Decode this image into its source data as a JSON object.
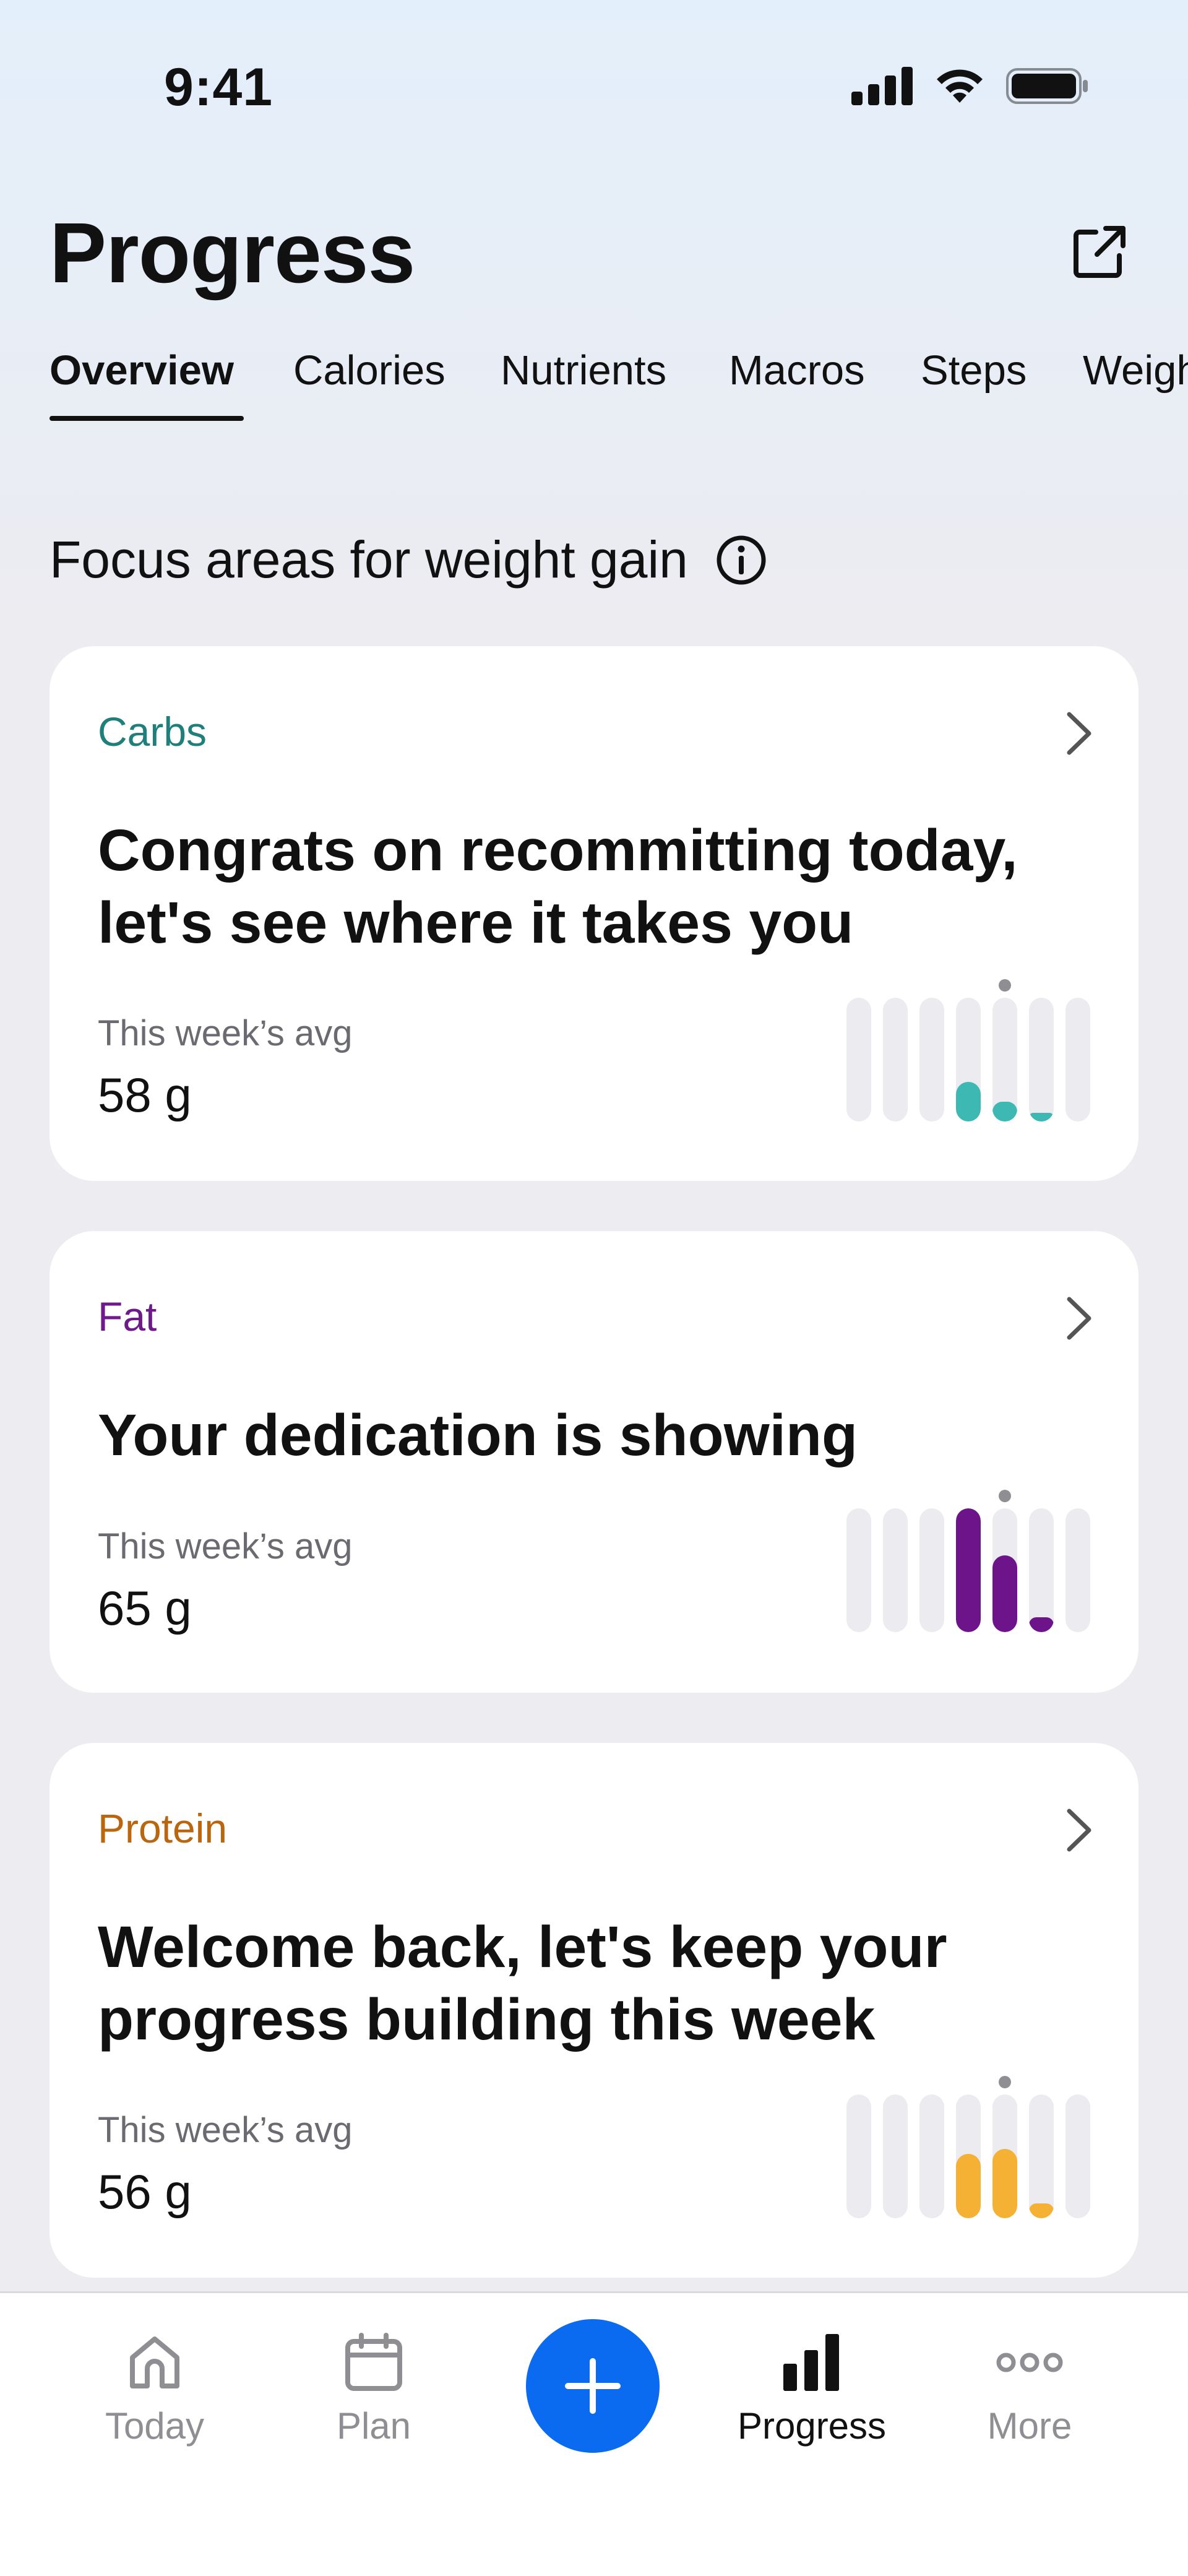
{
  "status_bar": {
    "time": "9:41"
  },
  "header": {
    "title": "Progress"
  },
  "tabs": [
    {
      "label": "Overview"
    },
    {
      "label": "Calories"
    },
    {
      "label": "Nutrients"
    },
    {
      "label": "Macros"
    },
    {
      "label": "Steps"
    },
    {
      "label": "Weight"
    }
  ],
  "section": {
    "heading": "Focus areas for weight gain"
  },
  "cards": [
    {
      "category": "Carbs",
      "category_color": "#1F7F7A",
      "bar_color": "#3DB8B2",
      "message": "Congrats on recommitting today, let's see where it takes you",
      "avg_label": "This week’s avg",
      "avg_value": "58 g",
      "daily_levels": [
        0,
        0,
        0,
        0.32,
        0.16,
        0.04,
        0
      ]
    },
    {
      "category": "Fat",
      "category_color": "#6E1A8C",
      "bar_color": "#6E148A",
      "message": "Your dedication is showing",
      "avg_label": "This week’s avg",
      "avg_value": "65 g",
      "daily_levels": [
        0,
        0,
        0,
        1.0,
        0.62,
        0.12,
        0
      ]
    },
    {
      "category": "Protein",
      "category_color": "#B9660E",
      "bar_color": "#F5B133",
      "message": "Welcome back, let's keep your progress building this week",
      "avg_label": "This week’s avg",
      "avg_value": "56 g",
      "daily_levels": [
        0,
        0,
        0,
        0.52,
        0.56,
        0.12,
        0
      ]
    }
  ],
  "bottom_nav": {
    "items": [
      {
        "label": "Today",
        "icon": "home-icon"
      },
      {
        "label": "Plan",
        "icon": "calendar-icon"
      },
      {
        "label": "Progress",
        "icon": "bar-chart-icon"
      },
      {
        "label": "More",
        "icon": "more-icon"
      }
    ],
    "add_icon": "plus-icon",
    "accent": "#0B6BF0"
  }
}
